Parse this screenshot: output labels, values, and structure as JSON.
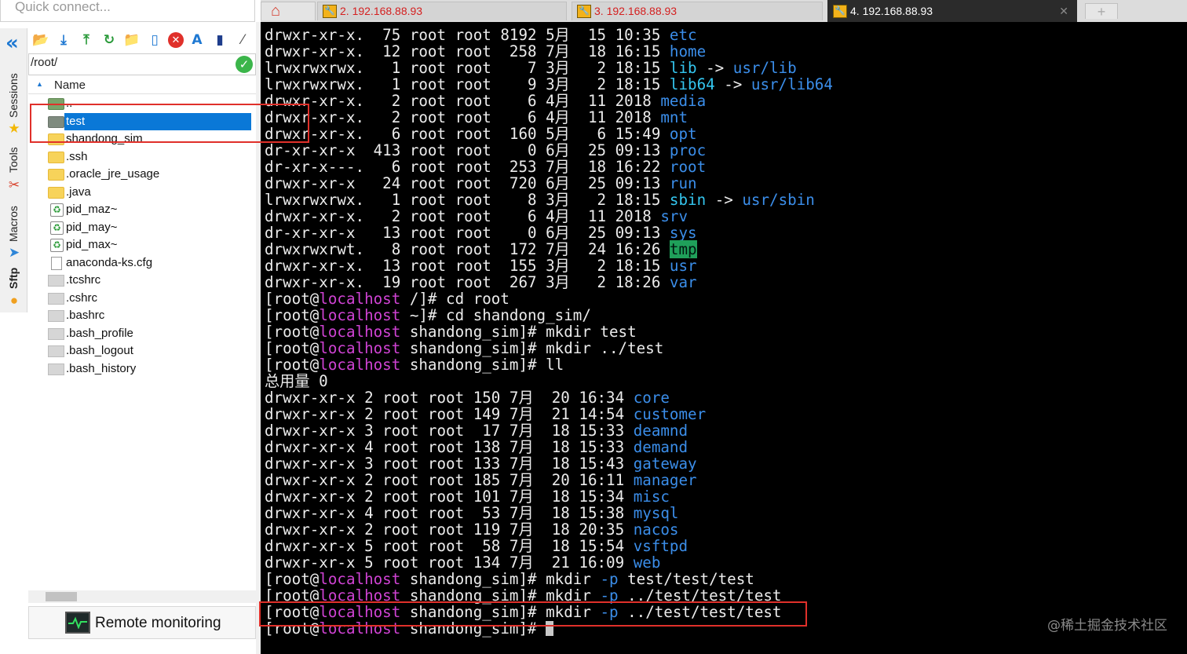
{
  "quick_connect": {
    "placeholder": "Quick connect..."
  },
  "side_tabs": [
    "Sessions",
    "Tools",
    "Macros",
    "Sftp"
  ],
  "sftp": {
    "path": "/root/",
    "column_name": "Name",
    "files": [
      {
        "name": "..",
        "type": "up"
      },
      {
        "name": "test",
        "type": "folder-grey",
        "selected": true
      },
      {
        "name": "shandong_sim",
        "type": "folder"
      },
      {
        "name": ".ssh",
        "type": "folder"
      },
      {
        "name": ".oracle_jre_usage",
        "type": "folder"
      },
      {
        "name": ".java",
        "type": "folder"
      },
      {
        "name": "pid_maz~",
        "type": "recycle"
      },
      {
        "name": "pid_may~",
        "type": "recycle"
      },
      {
        "name": "pid_max~",
        "type": "recycle"
      },
      {
        "name": "anaconda-ks.cfg",
        "type": "cfg"
      },
      {
        "name": ".tcshrc",
        "type": "file"
      },
      {
        "name": ".cshrc",
        "type": "file"
      },
      {
        "name": ".bashrc",
        "type": "file"
      },
      {
        "name": ".bash_profile",
        "type": "file"
      },
      {
        "name": ".bash_logout",
        "type": "file"
      },
      {
        "name": ".bash_history",
        "type": "file"
      }
    ],
    "remote_monitoring_label": "Remote monitoring"
  },
  "tabs": [
    {
      "label": "",
      "kind": "home"
    },
    {
      "label": "2. 192.168.88.93",
      "kind": "session"
    },
    {
      "label": "3. 192.168.88.93",
      "kind": "session"
    },
    {
      "label": "4. 192.168.88.93",
      "kind": "session",
      "active": true
    },
    {
      "label": "+",
      "kind": "new"
    }
  ],
  "terminal": {
    "prompt_host": "localhost",
    "lines": [
      [
        [
          "drwxr-xr-x.  75 root root 8192 5月  15 10:35 ",
          ""
        ],
        [
          "etc",
          "dir"
        ]
      ],
      [
        [
          "drwxr-xr-x.  12 root root  258 7月  18 16:15 ",
          ""
        ],
        [
          "home",
          "dir"
        ]
      ],
      [
        [
          "lrwxrwxrwx.   1 root root    7 3月   2 18:15 ",
          ""
        ],
        [
          "lib",
          "link"
        ],
        [
          " -> ",
          ""
        ],
        [
          "usr/lib",
          "dir"
        ]
      ],
      [
        [
          "lrwxrwxrwx.   1 root root    9 3月   2 18:15 ",
          ""
        ],
        [
          "lib64",
          "link"
        ],
        [
          " -> ",
          ""
        ],
        [
          "usr/lib64",
          "dir"
        ]
      ],
      [
        [
          "drwxr-xr-x.   2 root root    6 4月  11 2018 ",
          ""
        ],
        [
          "media",
          "dir"
        ]
      ],
      [
        [
          "drwxr-xr-x.   2 root root    6 4月  11 2018 ",
          ""
        ],
        [
          "mnt",
          "dir"
        ]
      ],
      [
        [
          "drwxr-xr-x.   6 root root  160 5月   6 15:49 ",
          ""
        ],
        [
          "opt",
          "dir"
        ]
      ],
      [
        [
          "dr-xr-xr-x  413 root root    0 6月  25 09:13 ",
          ""
        ],
        [
          "proc",
          "dir"
        ]
      ],
      [
        [
          "dr-xr-x---.   6 root root  253 7月  18 16:22 ",
          ""
        ],
        [
          "root",
          "dir"
        ]
      ],
      [
        [
          "drwxr-xr-x   24 root root  720 6月  25 09:13 ",
          ""
        ],
        [
          "run",
          "dir"
        ]
      ],
      [
        [
          "lrwxrwxrwx.   1 root root    8 3月   2 18:15 ",
          ""
        ],
        [
          "sbin",
          "link"
        ],
        [
          " -> ",
          ""
        ],
        [
          "usr/sbin",
          "dir"
        ]
      ],
      [
        [
          "drwxr-xr-x.   2 root root    6 4月  11 2018 ",
          ""
        ],
        [
          "srv",
          "dir"
        ]
      ],
      [
        [
          "dr-xr-xr-x   13 root root    0 6月  25 09:13 ",
          ""
        ],
        [
          "sys",
          "dir"
        ]
      ],
      [
        [
          "drwxrwxrwt.   8 root root  172 7月  24 16:26 ",
          ""
        ],
        [
          "tmp",
          "tmp"
        ]
      ],
      [
        [
          "drwxr-xr-x.  13 root root  155 3月   2 18:15 ",
          ""
        ],
        [
          "usr",
          "dir"
        ]
      ],
      [
        [
          "drwxr-xr-x.  19 root root  267 3月   2 18:26 ",
          ""
        ],
        [
          "var",
          "dir"
        ]
      ],
      [
        [
          "[root@",
          ""
        ],
        [
          "localhost",
          "host"
        ],
        [
          " /]# cd root",
          ""
        ]
      ],
      [
        [
          "[root@",
          ""
        ],
        [
          "localhost",
          "host"
        ],
        [
          " ~]# cd shandong_sim/",
          ""
        ]
      ],
      [
        [
          "[root@",
          ""
        ],
        [
          "localhost",
          "host"
        ],
        [
          " shandong_sim]# mkdir test",
          ""
        ]
      ],
      [
        [
          "[root@",
          ""
        ],
        [
          "localhost",
          "host"
        ],
        [
          " shandong_sim]# mkdir ../test",
          ""
        ]
      ],
      [
        [
          "[root@",
          ""
        ],
        [
          "localhost",
          "host"
        ],
        [
          " shandong_sim]# ll",
          ""
        ]
      ],
      [
        [
          "总用量 0",
          ""
        ]
      ],
      [
        [
          "drwxr-xr-x 2 root root 150 7月  20 16:34 ",
          ""
        ],
        [
          "core",
          "dir"
        ]
      ],
      [
        [
          "drwxr-xr-x 2 root root 149 7月  21 14:54 ",
          ""
        ],
        [
          "customer",
          "dir"
        ]
      ],
      [
        [
          "drwxr-xr-x 3 root root  17 7月  18 15:33 ",
          ""
        ],
        [
          "deamnd",
          "dir"
        ]
      ],
      [
        [
          "drwxr-xr-x 4 root root 138 7月  18 15:33 ",
          ""
        ],
        [
          "demand",
          "dir"
        ]
      ],
      [
        [
          "drwxr-xr-x 3 root root 133 7月  18 15:43 ",
          ""
        ],
        [
          "gateway",
          "dir"
        ]
      ],
      [
        [
          "drwxr-xr-x 2 root root 185 7月  20 16:11 ",
          ""
        ],
        [
          "manager",
          "dir"
        ]
      ],
      [
        [
          "drwxr-xr-x 2 root root 101 7月  18 15:34 ",
          ""
        ],
        [
          "misc",
          "dir"
        ]
      ],
      [
        [
          "drwxr-xr-x 4 root root  53 7月  18 15:38 ",
          ""
        ],
        [
          "mysql",
          "dir"
        ]
      ],
      [
        [
          "drwxr-xr-x 2 root root 119 7月  18 20:35 ",
          ""
        ],
        [
          "nacos",
          "dir"
        ]
      ],
      [
        [
          "drwxr-xr-x 5 root root  58 7月  18 15:54 ",
          ""
        ],
        [
          "vsftpd",
          "dir"
        ]
      ],
      [
        [
          "drwxr-xr-x 5 root root 134 7月  21 16:09 ",
          ""
        ],
        [
          "web",
          "dir"
        ]
      ],
      [
        [
          "[root@",
          ""
        ],
        [
          "localhost",
          "host"
        ],
        [
          " shandong_sim]# mkdir ",
          ""
        ],
        [
          "-p",
          "dir"
        ],
        [
          " test/test/test",
          ""
        ]
      ],
      [
        [
          "[root@",
          ""
        ],
        [
          "localhost",
          "host"
        ],
        [
          " shandong_sim]# mkdir ",
          ""
        ],
        [
          "-p",
          "dir"
        ],
        [
          " ../test/test/test",
          ""
        ]
      ],
      [
        [
          "[root@",
          ""
        ],
        [
          "localhost",
          "host"
        ],
        [
          " shandong_sim]# mkdir ",
          ""
        ],
        [
          "-p",
          "dir"
        ],
        [
          " ../test/test/test",
          ""
        ]
      ],
      [
        [
          "[root@",
          ""
        ],
        [
          "localhost",
          "host"
        ],
        [
          " shandong_sim]# ",
          ""
        ],
        [
          "",
          "cursor"
        ]
      ]
    ]
  },
  "watermark": "@稀土掘金技术社区",
  "colors": {
    "terminal_bg": "#000000",
    "terminal_fg": "#ececec",
    "dir": "#3b8eea",
    "link": "#34c6ef",
    "host": "#d043d4",
    "tmp_bg": "#1fa05a",
    "selection": "#0a78d7",
    "annotation": "#e0302a"
  }
}
